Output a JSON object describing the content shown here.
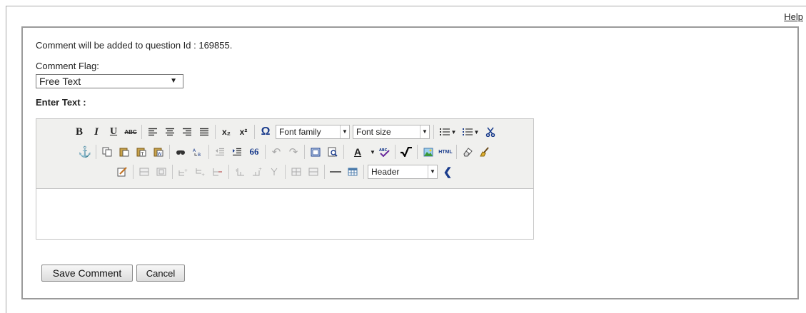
{
  "help_link": "Help",
  "info_text": "Comment will be added to question Id : 169855.",
  "comment_flag": {
    "label": "Comment Flag:",
    "selected": "Free Text",
    "arrow": "▼"
  },
  "enter_text_label": "Enter Text :",
  "toolbar": {
    "bold": "B",
    "italic": "I",
    "underline": "U",
    "strikethrough": "ABC",
    "subscript": "x₂",
    "superscript": "x²",
    "special_char": "Ω",
    "font_family": "Font family",
    "font_size": "Font size",
    "font_color": "A",
    "html_label": "HTML",
    "blockquote": "66",
    "format_select": "Header",
    "dropdown_arrow": "▼"
  },
  "buttons": {
    "save": "Save Comment",
    "cancel": "Cancel"
  },
  "colors": {
    "panel_border": "#9a9a9a",
    "toolbar_bg": "#f0f0ee",
    "font_color_underline": "#2222aa"
  }
}
